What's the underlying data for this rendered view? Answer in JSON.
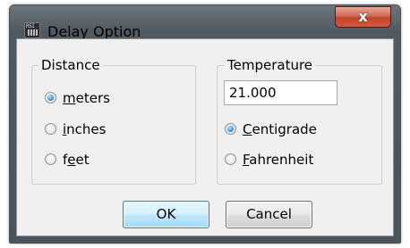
{
  "window": {
    "title": "Delay Option",
    "close_symbol": "x",
    "app_icon_text": "RSI"
  },
  "distance": {
    "legend": "Distance",
    "options": [
      {
        "pre": "",
        "ul": "m",
        "post": "eters",
        "checked": true
      },
      {
        "pre": "",
        "ul": "i",
        "post": "nches",
        "checked": false
      },
      {
        "pre": "f",
        "ul": "e",
        "post": "et",
        "checked": false
      }
    ]
  },
  "temperature": {
    "legend": "Temperature",
    "value": "21.000",
    "options": [
      {
        "pre": "",
        "ul": "C",
        "post": "entigrade",
        "checked": true
      },
      {
        "pre": "",
        "ul": "F",
        "post": "ahrenheit",
        "checked": false
      }
    ]
  },
  "buttons": {
    "ok": "OK",
    "cancel": "Cancel"
  },
  "colors": {
    "radio_selected": "#3d9ae0",
    "close_button": "#c24430",
    "default_button_border": "#3c7fb1"
  }
}
